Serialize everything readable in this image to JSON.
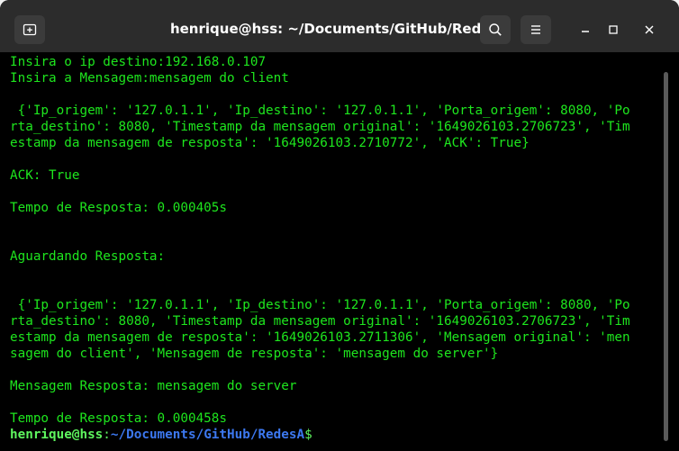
{
  "window": {
    "title": "henrique@hss: ~/Documents/GitHub/RedesA"
  },
  "icons": {
    "new_tab": "new-tab-icon",
    "search": "search-icon",
    "menu": "hamburger-menu-icon",
    "minimize": "minimize-icon",
    "maximize": "maximize-icon",
    "close": "close-icon"
  },
  "terminal": {
    "lines": [
      "Insira o ip destino:192.168.0.107",
      "Insira a Mensagem:mensagem do client",
      "",
      " {'Ip_origem': '127.0.1.1', 'Ip_destino': '127.0.1.1', 'Porta_origem': 8080, 'Po",
      "rta_destino': 8080, 'Timestamp da mensagem original': '1649026103.2706723', 'Tim",
      "estamp da mensagem de resposta': '1649026103.2710772', 'ACK': True}",
      "",
      "ACK: True",
      "",
      "Tempo de Resposta: 0.000405s",
      "",
      "",
      "Aguardando Resposta:",
      "",
      "",
      " {'Ip_origem': '127.0.1.1', 'Ip_destino': '127.0.1.1', 'Porta_origem': 8080, 'Po",
      "rta_destino': 8080, 'Timestamp da mensagem original': '1649026103.2706723', 'Tim",
      "estamp da mensagem de resposta': '1649026103.2711306', 'Mensagem original': 'men",
      "sagem do client', 'Mensagem de resposta': 'mensagem do server'}",
      "",
      "Mensagem Resposta: mensagem do server",
      "",
      "Tempo de Resposta: 0.000458s"
    ],
    "prompt": {
      "user_host": "henrique@hss",
      "separator": ":",
      "path": "~/Documents/GitHub/RedesA",
      "symbol": "$"
    }
  },
  "colors": {
    "terminal_text": "#1ee61e",
    "prompt_user": "#5ef55e",
    "prompt_path": "#3c78f0",
    "titlebar": "#2c2c2c",
    "background": "#000000"
  }
}
